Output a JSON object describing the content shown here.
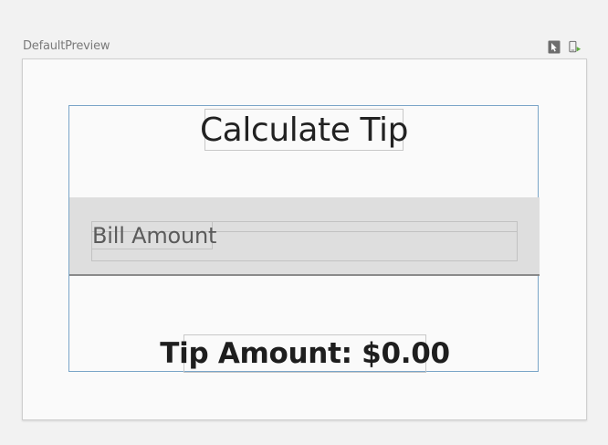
{
  "preview": {
    "name": "DefaultPreview"
  },
  "toolbar": {
    "icons": [
      "interactive-mode-icon",
      "deploy-preview-icon"
    ]
  },
  "app": {
    "title": "Calculate Tip",
    "bill_field": {
      "label": "Bill Amount",
      "value": ""
    },
    "tip_text": "Tip Amount: $0.00"
  },
  "colors": {
    "canvas_bg": "#f2f2f2",
    "frame_bg": "#fafafa",
    "field_bg": "#dedede",
    "column_outline": "#7aa5c8",
    "deploy_icon_green": "#5eae3e"
  }
}
